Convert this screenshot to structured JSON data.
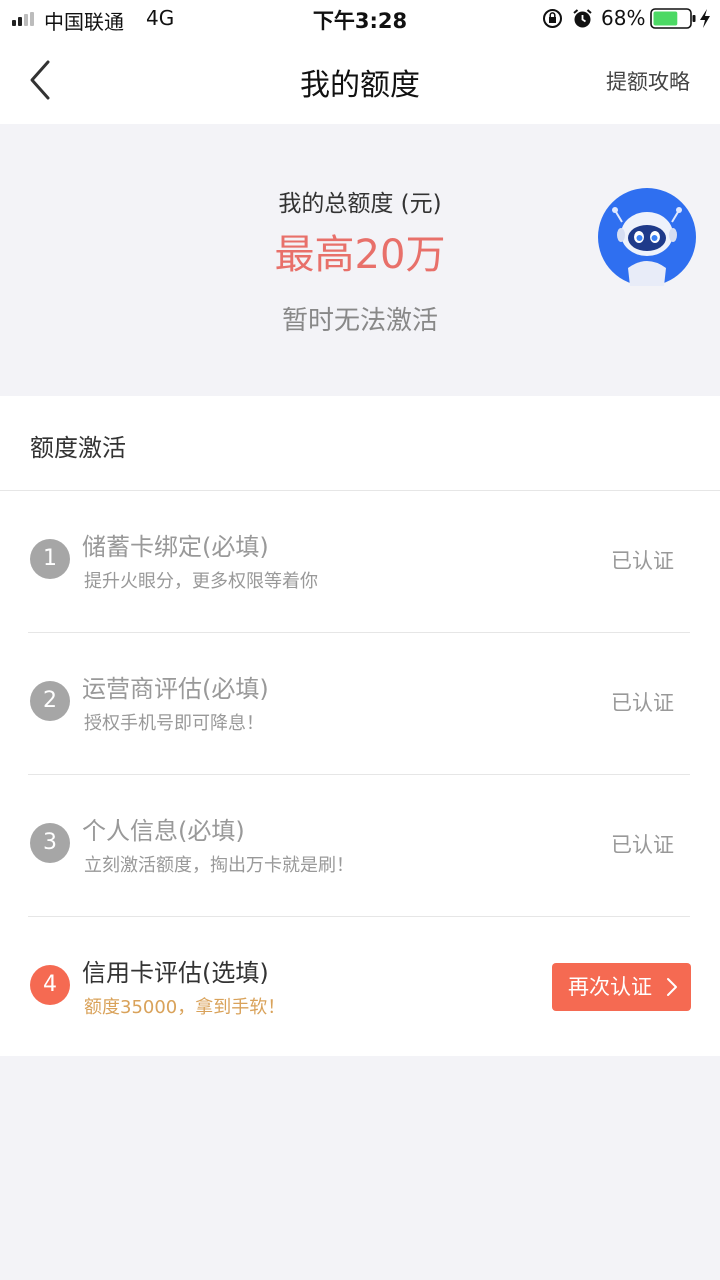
{
  "status_bar": {
    "carrier": "中国联通",
    "network": "4G",
    "time": "下午3:28",
    "battery_percent": "68%",
    "battery_level": 0.68,
    "signal_bars_active": 2,
    "signal_bars_total": 4
  },
  "nav": {
    "title": "我的额度",
    "right_link": "提额攻略"
  },
  "hero": {
    "label": "我的总额度 (元)",
    "amount": "最高20万",
    "status": "暂时无法激活"
  },
  "section": {
    "title": "额度激活",
    "steps": [
      {
        "num": "1",
        "title": "储蓄卡绑定(必填)",
        "desc": "提升火眼分，更多权限等着你",
        "status": "已认证"
      },
      {
        "num": "2",
        "title": "运营商评估(必填)",
        "desc": "授权手机号即可降息！",
        "status": "已认证"
      },
      {
        "num": "3",
        "title": "个人信息(必填)",
        "desc": "立刻激活额度，掏出万卡就是刷！",
        "status": "已认证"
      },
      {
        "num": "4",
        "title": "信用卡评估(选填)",
        "desc": "额度35000，拿到手软！",
        "action": "再次认证"
      }
    ]
  },
  "colors": {
    "accent": "#f56a52",
    "amount": "#e8706a",
    "highlight_text": "#d9a25a",
    "background": "#f3f3f7"
  }
}
